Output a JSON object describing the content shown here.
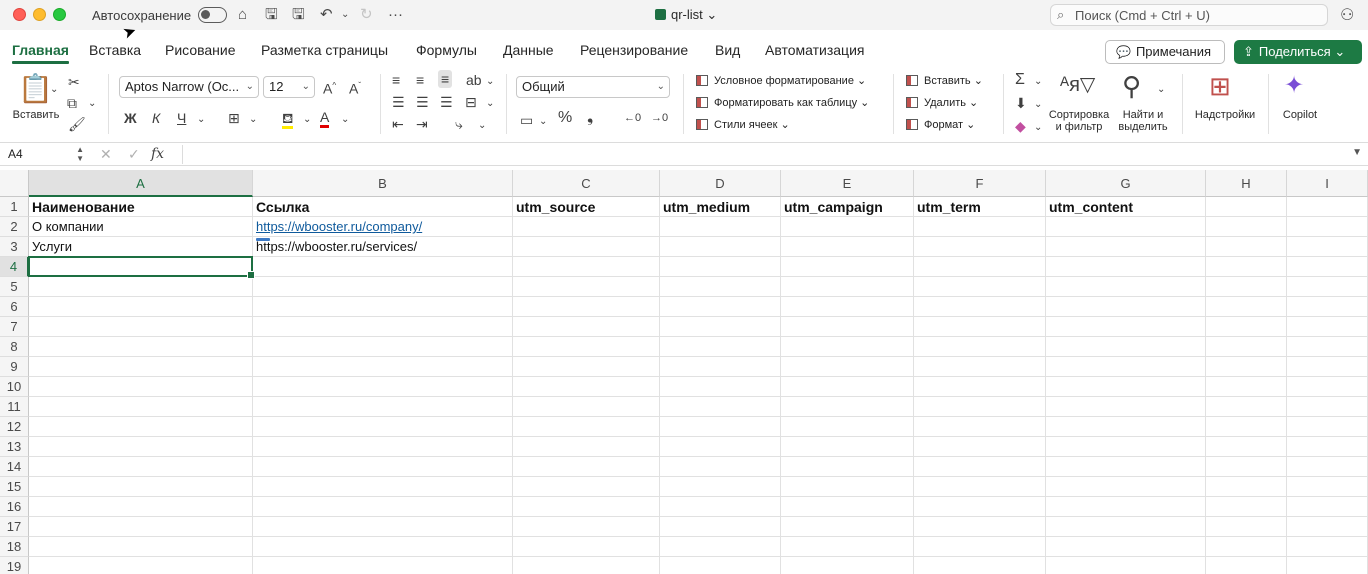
{
  "titlebar": {
    "autosave_label": "Автосохранение",
    "doc_title": "qr-list",
    "search_placeholder": "Поиск (Cmd + Ctrl + U)",
    "icons": [
      "home-icon",
      "save-icon",
      "save-as-icon",
      "undo-icon",
      "redo-icon",
      "more-icon",
      "person-icon"
    ]
  },
  "tabs": [
    "Главная",
    "Вставка",
    "Рисование",
    "Разметка страницы",
    "Формулы",
    "Данные",
    "Рецензирование",
    "Вид",
    "Автоматизация"
  ],
  "header_buttons": {
    "comments": "Примечания",
    "share": "Поделиться"
  },
  "ribbon": {
    "paste_label": "Вставить",
    "font_name": "Aptos Narrow (Ос...",
    "font_size": "12",
    "bold": "Ж",
    "italic": "К",
    "underline": "Ч",
    "number_format": "Общий",
    "conditional_formatting": "Условное форматирование",
    "format_as_table": "Форматировать как таблицу",
    "cell_styles": "Стили ячеек",
    "insert": "Вставить",
    "delete": "Удалить",
    "format": "Формат",
    "sort_filter_line1": "Сортировка",
    "sort_filter_line2": "и фильтр",
    "find_select_line1": "Найти и",
    "find_select_line2": "выделить",
    "addins": "Надстройки",
    "copilot": "Copilot"
  },
  "formula_bar": {
    "name_box": "A4",
    "formula": ""
  },
  "sheet": {
    "columns": [
      "A",
      "B",
      "C",
      "D",
      "E",
      "F",
      "G",
      "H",
      "I"
    ],
    "rows": [
      "1",
      "2",
      "3",
      "4",
      "5",
      "6",
      "7",
      "8",
      "9",
      "10",
      "11",
      "12",
      "13",
      "14",
      "15",
      "16",
      "17",
      "18",
      "19"
    ],
    "header_row": [
      "Наименование",
      "Ссылка",
      "utm_source",
      "utm_medium",
      "utm_campaign",
      "utm_term",
      "utm_content"
    ],
    "row2": {
      "A": "О компании",
      "B": "https://wbooster.ru/company/"
    },
    "row3": {
      "A": "Услуги",
      "B": "https://wbooster.ru/services/"
    },
    "selected_cell": "A4"
  },
  "colors": {
    "accent": "#1d6f42",
    "share_button": "#1d7a44",
    "link": "#0f5a9c"
  }
}
